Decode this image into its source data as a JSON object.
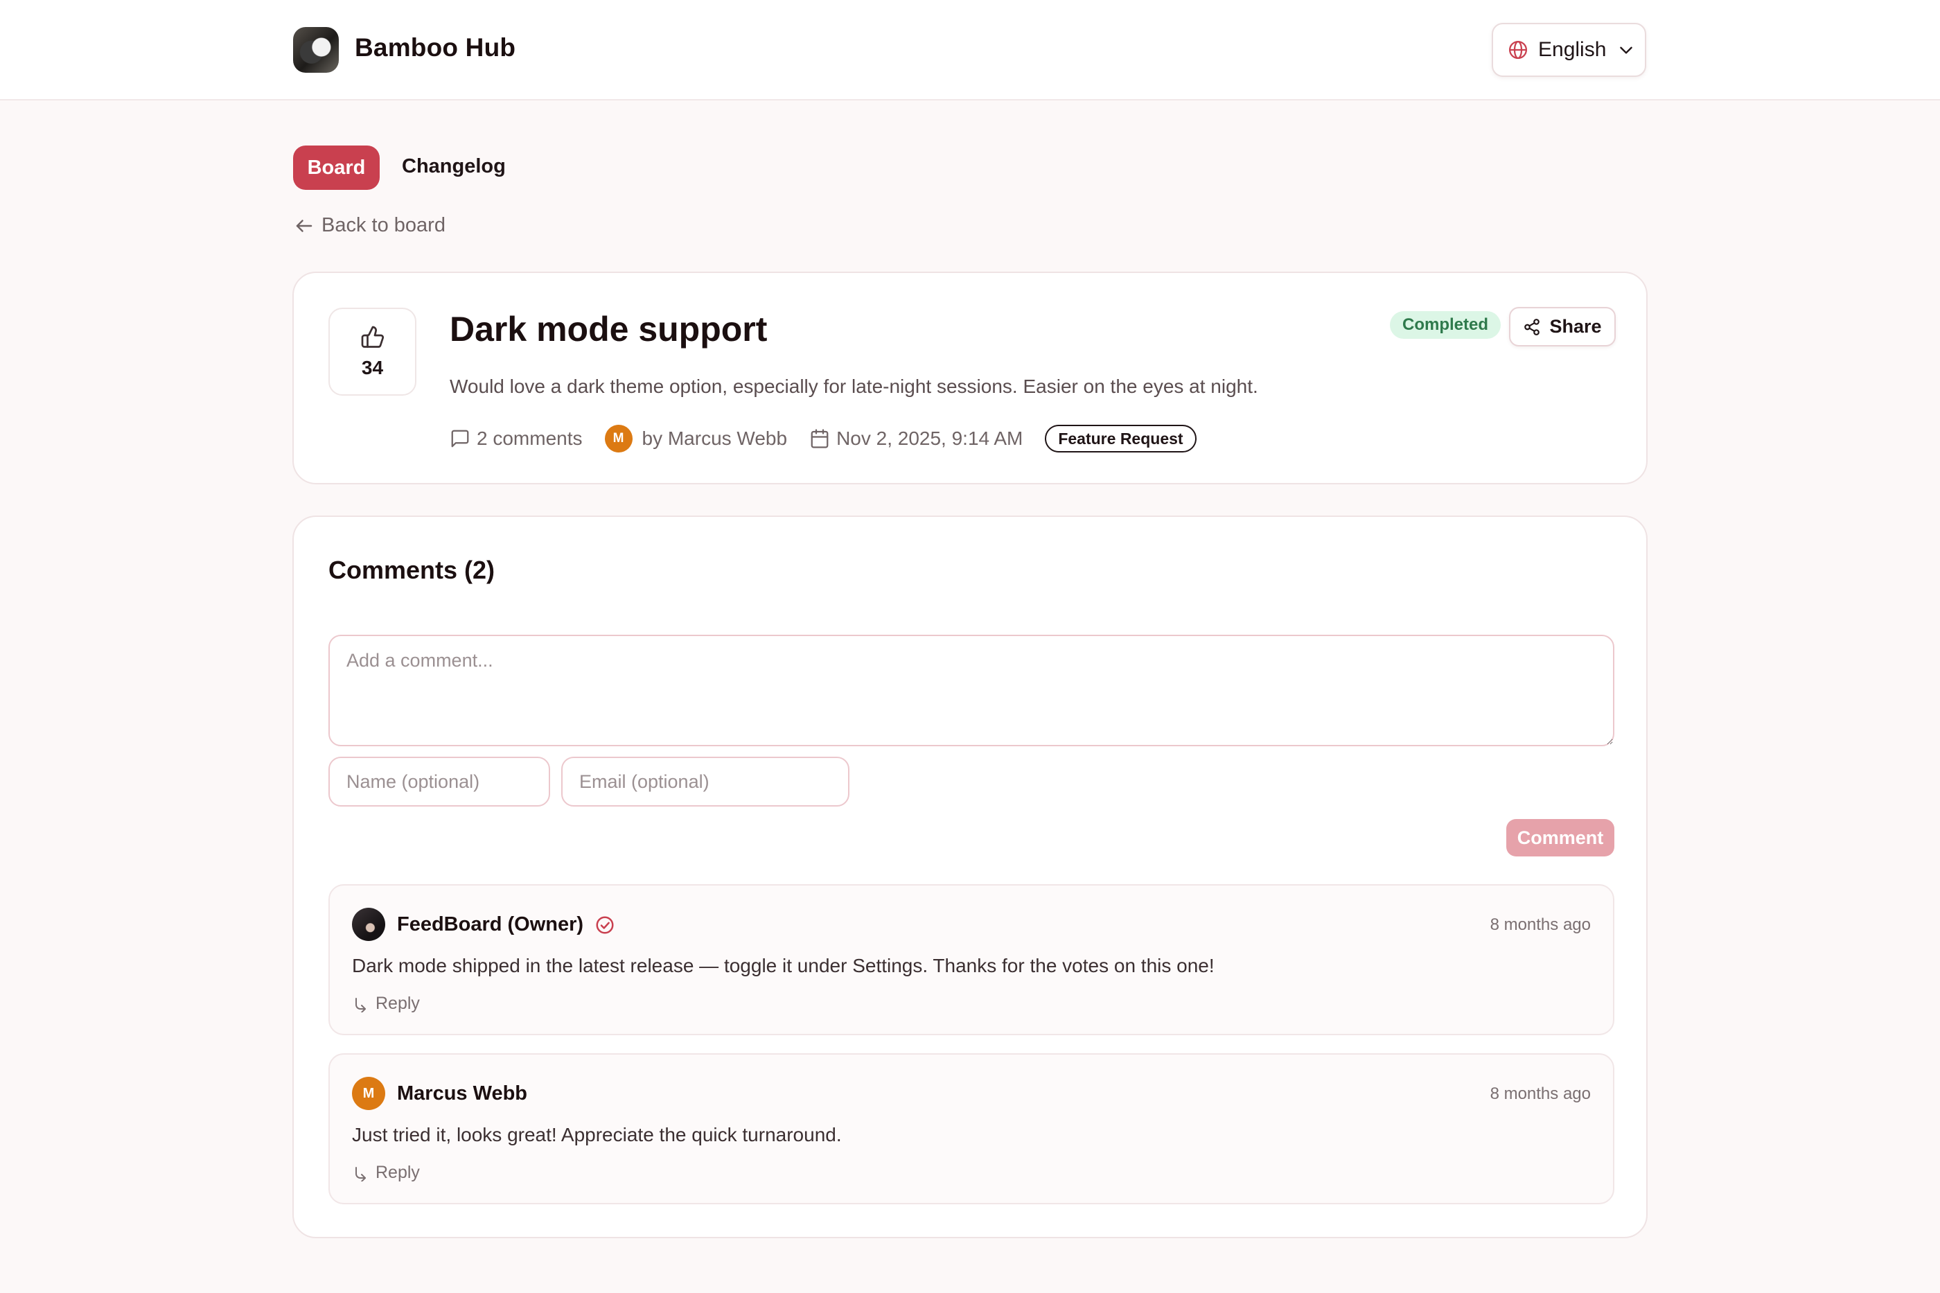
{
  "header": {
    "brand": "Bamboo Hub",
    "language": "English"
  },
  "nav": {
    "tabs": [
      "Board",
      "Changelog"
    ],
    "active_tab": "Board",
    "back_label": "Back to board"
  },
  "post": {
    "votes": "34",
    "title": "Dark mode support",
    "status": "Completed",
    "share_label": "Share",
    "description": "Would love a dark theme option, especially for late-night sessions. Easier on the eyes at night.",
    "comment_count_label": "2 comments",
    "author_initial": "M",
    "author_label": "by Marcus Webb",
    "date": "Nov 2, 2025, 9:14 AM",
    "category": "Feature Request"
  },
  "comments_section": {
    "title": "Comments (2)",
    "textarea_placeholder": "Add a comment...",
    "name_placeholder": "Name (optional)",
    "email_placeholder": "Email (optional)",
    "submit_label": "Comment",
    "items": [
      {
        "author": "FeedBoard (Owner)",
        "time": "8 months ago",
        "body": "Dark mode shipped in the latest release — toggle it under Settings. Thanks for the votes on this one!",
        "reply_label": "Reply"
      },
      {
        "author": "Marcus Webb",
        "avatar_initial": "M",
        "time": "8 months ago",
        "body": "Just tried it, looks great! Appreciate the quick turnaround.",
        "reply_label": "Reply"
      }
    ]
  },
  "colors": {
    "accent": "#c9404f",
    "status_bg": "#dcf6e6",
    "status_text": "#2f7a4c",
    "avatar_orange": "#dc7a13",
    "comment_button_disabled": "#e6a2aa",
    "page_bg": "#fcf8f8"
  },
  "icons": {
    "language": "globe-icon",
    "language_toggle": "chevron-down-icon",
    "back": "arrow-left-icon",
    "vote": "thumbs-up-icon",
    "share": "share-icon",
    "comments": "message-square-icon",
    "date": "calendar-icon",
    "owner_verified": "check-circle-icon",
    "reply": "corner-down-right-icon"
  }
}
